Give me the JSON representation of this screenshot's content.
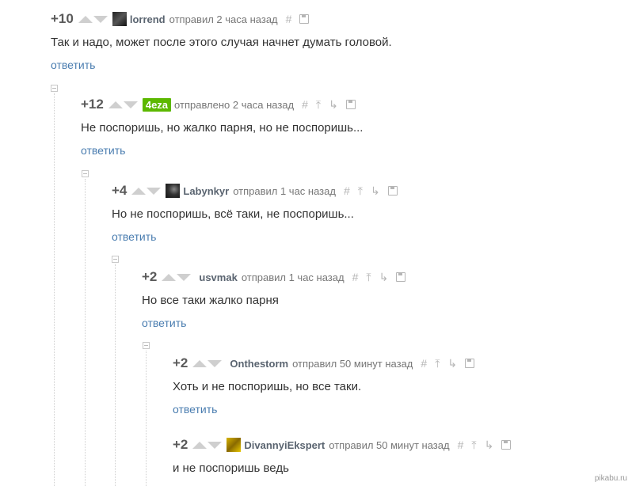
{
  "comments": [
    {
      "rating": "+10",
      "username": "lorrend",
      "time": "отправил 2 часа назад",
      "text": "Так и надо, может после этого случая начнет думать головой.",
      "reply": "ответить"
    },
    {
      "rating": "+12",
      "username": "4eza",
      "time": "отправлено 2 часа назад",
      "text": "Не поспоришь, но жалко парня, но не поспоришь...",
      "reply": "ответить"
    },
    {
      "rating": "+4",
      "username": "Labynkyr",
      "time": "отправил 1 час назад",
      "text": "Но не поспоришь, всё таки, не поспоришь...",
      "reply": "ответить"
    },
    {
      "rating": "+2",
      "username": "usvmak",
      "time": "отправил 1 час назад",
      "text": "Но все таки жалко парня",
      "reply": "ответить"
    },
    {
      "rating": "+2",
      "username": "Onthestorm",
      "time": "отправил 50 минут назад",
      "text": "Хоть и не поспоришь, но все таки.",
      "reply": "ответить"
    },
    {
      "rating": "+2",
      "username": "DivannyiEkspert",
      "time": "отправил 50 минут назад",
      "text": "и не поспоришь ведь",
      "reply": ""
    }
  ],
  "icons": {
    "link": "#",
    "up": "⤒",
    "down": "↳"
  },
  "accent": "#4a7db0",
  "badge_color": "#5cb800",
  "watermark": "pikabu.ru"
}
